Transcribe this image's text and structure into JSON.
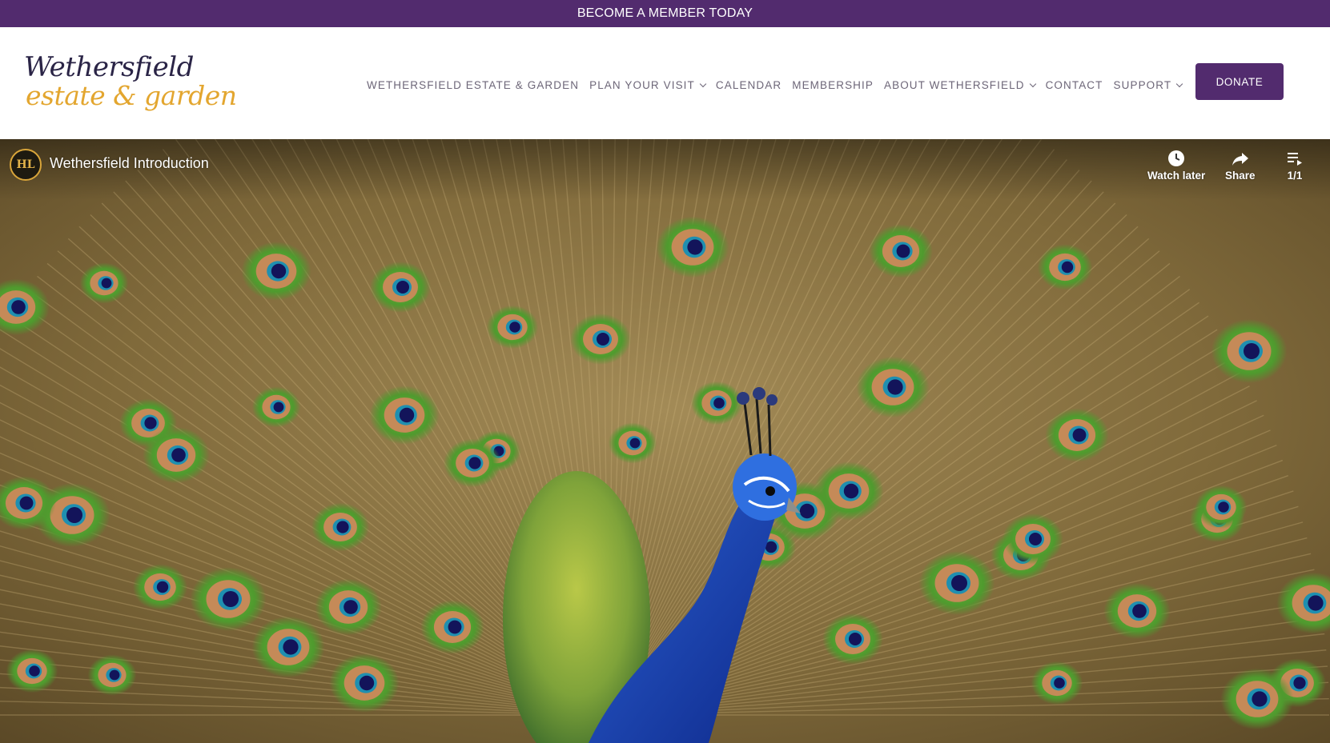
{
  "banner": {
    "text": "BECOME A MEMBER TODAY"
  },
  "logo": {
    "line1": "Wethersfield",
    "line2": "estate & garden"
  },
  "nav": {
    "items": [
      {
        "label": "WETHERSFIELD ESTATE & GARDEN",
        "has_dropdown": false
      },
      {
        "label": "PLAN YOUR VISIT",
        "has_dropdown": true
      },
      {
        "label": "CALENDAR",
        "has_dropdown": false
      },
      {
        "label": "MEMBERSHIP",
        "has_dropdown": false
      },
      {
        "label": "ABOUT WETHERSFIELD",
        "has_dropdown": true
      },
      {
        "label": "CONTACT",
        "has_dropdown": false
      },
      {
        "label": "SUPPORT",
        "has_dropdown": true
      }
    ]
  },
  "donate": {
    "label": "DONATE"
  },
  "video": {
    "title": "Wethersfield Introduction",
    "channel_avatar_text": "HL",
    "watch_later_label": "Watch later",
    "share_label": "Share",
    "playlist_label": "1/1",
    "subject": "peacock"
  },
  "colors": {
    "brand_purple": "#522b6e",
    "logo_navy": "#2a2446",
    "logo_gold": "#e3a62f",
    "nav_text": "#6d6678"
  }
}
